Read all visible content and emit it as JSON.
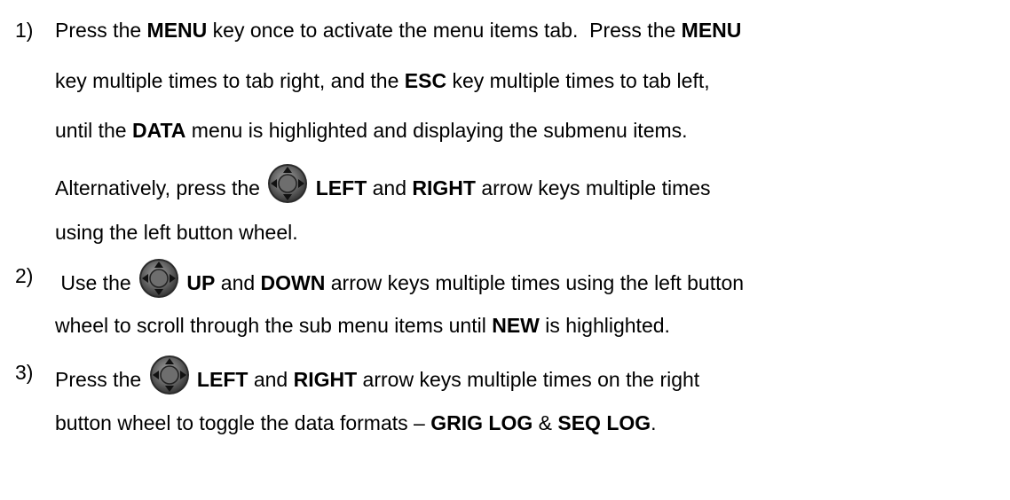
{
  "steps": [
    {
      "number": "1)",
      "lines": [
        {
          "parts": [
            {
              "t": "Press the "
            },
            {
              "t": "MENU",
              "b": true
            },
            {
              "t": " key once to activate the menu items tab.  Press the "
            },
            {
              "t": "MENU",
              "b": true
            }
          ]
        },
        {
          "parts": [
            {
              "t": "key multiple times to tab right, and the "
            },
            {
              "t": "ESC",
              "b": true
            },
            {
              "t": " key multiple times to tab left,"
            }
          ]
        },
        {
          "parts": [
            {
              "t": "until the "
            },
            {
              "t": "DATA",
              "b": true
            },
            {
              "t": " menu is highlighted and displaying the submenu items."
            }
          ]
        },
        {
          "parts": [
            {
              "t": "Alternatively, press the "
            },
            {
              "icon": "button-wheel-icon"
            },
            {
              "t": " LEFT",
              "b": true
            },
            {
              "t": " and "
            },
            {
              "t": "RIGHT",
              "b": true
            },
            {
              "t": " arrow keys multiple times"
            }
          ]
        },
        {
          "parts": [
            {
              "t": "using the left button wheel."
            }
          ]
        }
      ]
    },
    {
      "number": "2)",
      "lines": [
        {
          "parts": [
            {
              "t": " Use the "
            },
            {
              "icon": "button-wheel-icon"
            },
            {
              "t": " UP",
              "b": true
            },
            {
              "t": " and "
            },
            {
              "t": "DOWN",
              "b": true
            },
            {
              "t": " arrow keys multiple times using the left button"
            }
          ]
        },
        {
          "parts": [
            {
              "t": "wheel to scroll through the sub menu items until "
            },
            {
              "t": "NEW",
              "b": true
            },
            {
              "t": " is highlighted."
            }
          ]
        }
      ]
    },
    {
      "number": "3)",
      "lines": [
        {
          "parts": [
            {
              "t": "Press the "
            },
            {
              "icon": "button-wheel-icon"
            },
            {
              "t": " LEFT",
              "b": true
            },
            {
              "t": " and "
            },
            {
              "t": "RIGHT",
              "b": true
            },
            {
              "t": " arrow keys multiple times on the right"
            }
          ]
        },
        {
          "parts": [
            {
              "t": "button wheel to toggle the data formats – "
            },
            {
              "t": "GRIG LOG",
              "b": true
            },
            {
              "t": " & "
            },
            {
              "t": "SEQ LOG",
              "b": true
            },
            {
              "t": "."
            }
          ]
        }
      ]
    }
  ]
}
